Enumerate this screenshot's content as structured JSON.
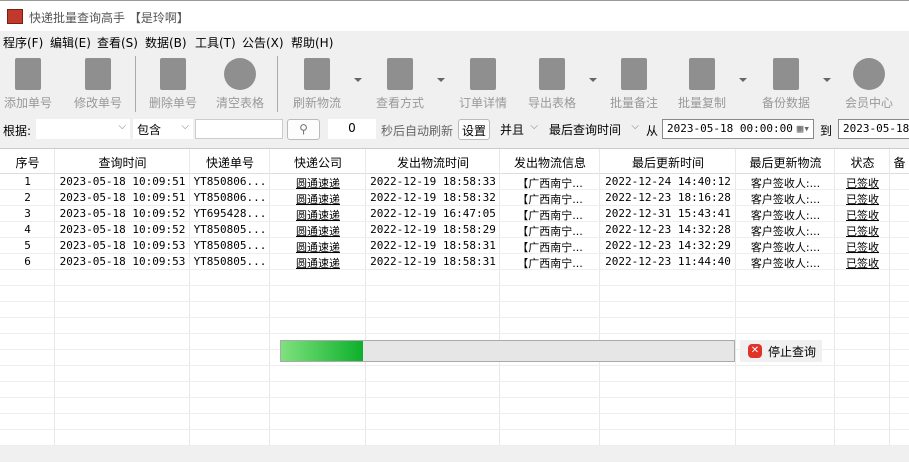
{
  "window": {
    "title": "快递批量查询高手 【是玲啊】"
  },
  "menu": [
    "程序(F)",
    "编辑(E)",
    "查看(S)",
    "数据(B)",
    "工具(T)",
    "公告(X)",
    "帮助(H)"
  ],
  "toolbar": [
    "添加单号",
    "修改单号",
    "删除单号",
    "清空表格",
    "刷新物流",
    "查看方式",
    "订单详情",
    "导出表格",
    "批量备注",
    "批量复制",
    "备份数据",
    "会员中心"
  ],
  "filter": {
    "by_label": "根据:",
    "by_value": "",
    "match": "包含",
    "keyword": "",
    "refresh_seconds": "0",
    "auto_refresh_label": "秒后自动刷新",
    "settings_button": "设置",
    "logic": "并且",
    "time_field": "最后查询时间",
    "from_label": "从",
    "from_value": "2023-05-18 00:00:00",
    "to_label": "到",
    "to_value": "2023-05-18"
  },
  "table": {
    "headers": [
      "序号",
      "查询时间",
      "快递单号",
      "快递公司",
      "发出物流时间",
      "发出物流信息",
      "最后更新时间",
      "最后更新物流",
      "状态",
      "备"
    ],
    "rows": [
      [
        "1",
        "2023-05-18 10:09:51",
        "YT850806...",
        "圆通速递",
        "2022-12-19 18:58:33",
        "【广西南宁...",
        "2022-12-24 14:40:12",
        "客户签收人:...",
        "已签收"
      ],
      [
        "2",
        "2023-05-18 10:09:51",
        "YT850806...",
        "圆通速递",
        "2022-12-19 18:58:32",
        "【广西南宁...",
        "2022-12-23 18:16:28",
        "客户签收人:...",
        "已签收"
      ],
      [
        "3",
        "2023-05-18 10:09:52",
        "YT695428...",
        "圆通速递",
        "2022-12-19 16:47:05",
        "【广西南宁...",
        "2022-12-31 15:43:41",
        "客户签收人:...",
        "已签收"
      ],
      [
        "4",
        "2023-05-18 10:09:52",
        "YT850805...",
        "圆通速递",
        "2022-12-19 18:58:29",
        "【广西南宁...",
        "2022-12-23 14:32:28",
        "客户签收人:...",
        "已签收"
      ],
      [
        "5",
        "2023-05-18 10:09:53",
        "YT850805...",
        "圆通速递",
        "2022-12-19 18:58:31",
        "【广西南宁...",
        "2022-12-23 14:32:29",
        "客户签收人:...",
        "已签收"
      ],
      [
        "6",
        "2023-05-18 10:09:53",
        "YT850805...",
        "圆通速递",
        "2022-12-19 18:58:31",
        "【广西南宁...",
        "2022-12-23 11:44:40",
        "客户签收人:...",
        "已签收"
      ]
    ]
  },
  "progress": {
    "percent": 18
  },
  "stop_button": "停止查询"
}
